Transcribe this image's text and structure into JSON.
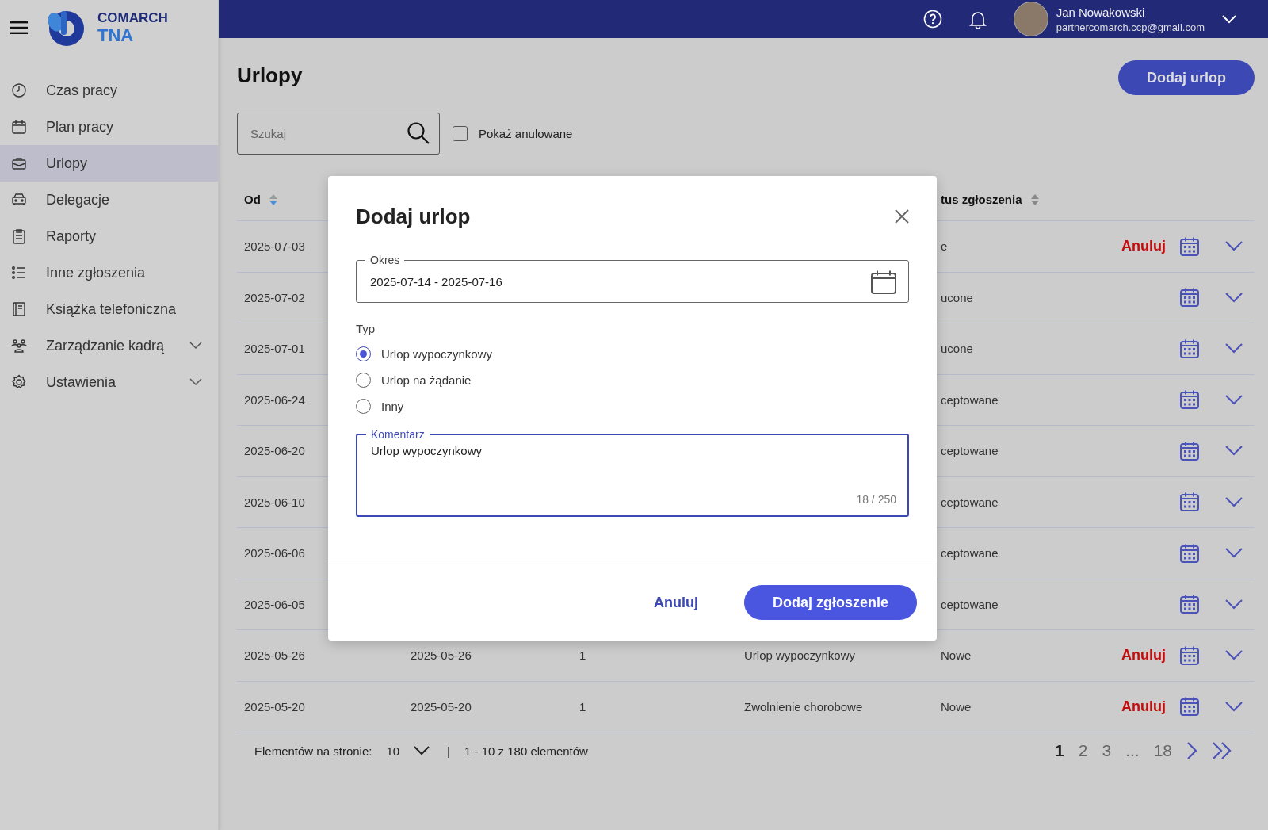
{
  "sidebar": {
    "logo": {
      "brand": "COMARCH",
      "product": "TNA"
    },
    "items": [
      {
        "label": "Czas pracy",
        "selected": false,
        "has_submenu": false
      },
      {
        "label": "Plan pracy",
        "selected": false,
        "has_submenu": false
      },
      {
        "label": "Urlopy",
        "selected": true,
        "has_submenu": false
      },
      {
        "label": "Delegacje",
        "selected": false,
        "has_submenu": false
      },
      {
        "label": "Raporty",
        "selected": false,
        "has_submenu": false
      },
      {
        "label": "Inne zgłoszenia",
        "selected": false,
        "has_submenu": false
      },
      {
        "label": "Książka telefoniczna",
        "selected": false,
        "has_submenu": false
      },
      {
        "label": "Zarządzanie kadrą",
        "selected": false,
        "has_submenu": true
      },
      {
        "label": "Ustawienia",
        "selected": false,
        "has_submenu": true
      }
    ]
  },
  "topbar": {
    "user_name": "Jan Nowakowski",
    "user_email": "partnercomarch.ccp@gmail.com"
  },
  "page": {
    "title": "Urlopy",
    "add_button": "Dodaj urlop",
    "search": {
      "placeholder": "Szukaj"
    },
    "show_cancelled": {
      "label": "Pokaż anulowane",
      "checked": false
    }
  },
  "table": {
    "header": {
      "od": {
        "label": "Od",
        "sorted": true
      },
      "status": {
        "label": "tus zgłoszenia",
        "sorted": false
      }
    },
    "rows": [
      {
        "od": "2025-07-03",
        "status": "e",
        "cancel": "Anuluj"
      },
      {
        "od": "2025-07-02",
        "status": "ucone"
      },
      {
        "od": "2025-07-01",
        "status": "ucone"
      },
      {
        "od": "2025-06-24",
        "status": "ceptowane"
      },
      {
        "od": "2025-06-20",
        "status": "ceptowane"
      },
      {
        "od": "2025-06-10",
        "status": "ceptowane"
      },
      {
        "od": "2025-06-06",
        "status": "ceptowane"
      },
      {
        "od": "2025-06-05",
        "status": "ceptowane"
      },
      {
        "od": "2025-05-26",
        "do": "2025-05-26",
        "days": "1",
        "type": "Urlop wypoczynkowy",
        "status": "Nowe",
        "cancel": "Anuluj"
      },
      {
        "od": "2025-05-20",
        "do": "2025-05-20",
        "days": "1",
        "type": "Zwolnienie chorobowe",
        "status": "Nowe",
        "cancel": "Anuluj"
      }
    ]
  },
  "pagination": {
    "per_page_label": "Elementów na stronie:",
    "per_page": "10",
    "separator": "|",
    "range": "1 - 10 z 180 elementów",
    "pages": [
      {
        "label": "1",
        "selected": true
      },
      {
        "label": "2",
        "selected": false
      },
      {
        "label": "3",
        "selected": false
      },
      {
        "label": "...",
        "selected": false
      },
      {
        "label": "18",
        "selected": false
      }
    ]
  },
  "dialog": {
    "title": "Dodaj urlop",
    "period": {
      "label": "Okres",
      "value": "2025-07-14 - 2025-07-16"
    },
    "type_label": "Typ",
    "options": [
      {
        "label": "Urlop wypoczynkowy",
        "selected": true
      },
      {
        "label": "Urlop na żądanie",
        "selected": false
      },
      {
        "label": "Inny",
        "selected": false
      }
    ],
    "comment": {
      "label": "Komentarz",
      "value": "Urlop wypoczynkowy",
      "counter": "18 / 250",
      "focused": true
    },
    "cancel": "Anuluj",
    "submit": "Dodaj zgłoszenie"
  }
}
